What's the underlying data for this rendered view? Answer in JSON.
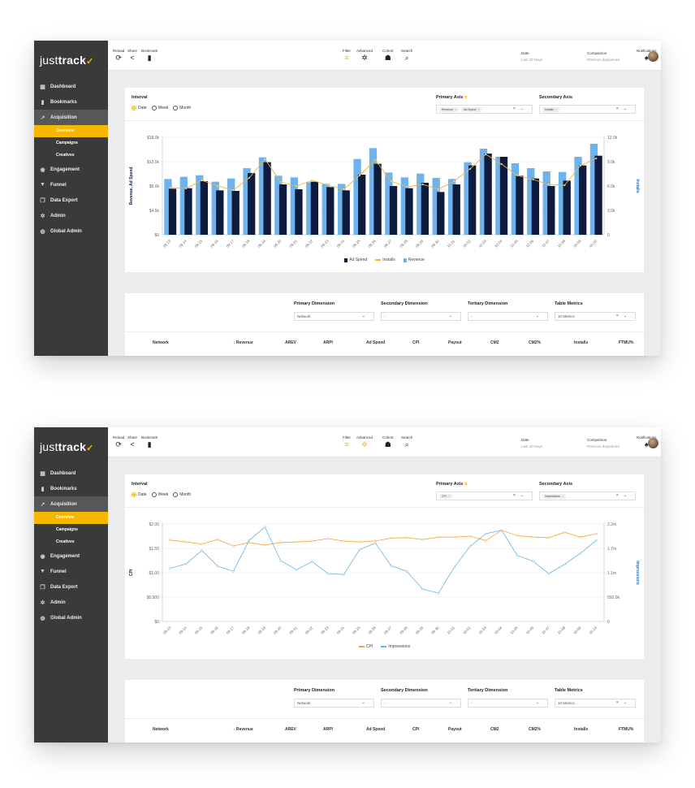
{
  "app": {
    "logo_main": "just",
    "logo_bold": "track",
    "toolbar": {
      "reload": "Reload",
      "share": "Share",
      "bookmark": "Bookmark",
      "filter": "Filter",
      "advanced": "Advanced",
      "cohort": "Cohort",
      "search": "Search"
    },
    "date_label": "Date",
    "date_value": "Last 28 Days",
    "comparison_label": "Comparison",
    "comparison_value": "Previous day/period",
    "notifications": "Notifications",
    "nav": [
      "Dashboard",
      "Bookmarks",
      "Acquisition"
    ],
    "subnav": [
      "Overview",
      "Campaigns",
      "Creatives"
    ],
    "nav2": [
      "Engagement",
      "Funnel",
      "Data Export",
      "Admin",
      "Global Admin"
    ],
    "interval_title": "Interval",
    "intervals": [
      "Date",
      "Week",
      "Month"
    ],
    "primary_axis_title": "Primary Axis",
    "secondary_axis_title": "Secondary Axis",
    "dimensions": {
      "primary": "Primary Dimension",
      "secondary": "Secondary Dimension",
      "tertiary": "Tertiary Dimension",
      "metrics": "Table Metrics",
      "primary_value": "Network",
      "secondary_value": "-",
      "tertiary_value": "-",
      "metrics_value": "10 Metrics"
    },
    "table_headers": [
      "Network",
      "↓ Revenue",
      "AREV",
      "ARPI",
      "Ad Spend",
      "CPI",
      "Payout",
      "CM2",
      "CM2%",
      "Installs",
      "FTMU%"
    ],
    "colors": {
      "accent": "#f5b800",
      "sidebar": "#3a3a3a",
      "revenue": "#6fb3ee",
      "adspend": "#0e1b3d",
      "installs": "#f3b233",
      "cpi": "#f3a233",
      "impressions": "#6ab3e0"
    }
  },
  "screens": [
    {
      "primary_chips": [
        "Revenue",
        "Ad Spend"
      ],
      "secondary_chips": [
        "Installs"
      ],
      "chart_data": {
        "type": "bar",
        "categories": [
          "09.13",
          "09.14",
          "09.15",
          "09.16",
          "09.17",
          "09.18",
          "09.19",
          "09.20",
          "09.21",
          "09.22",
          "09.23",
          "09.24",
          "09.25",
          "09.26",
          "09.27",
          "09.28",
          "09.29",
          "09.30",
          "10.01",
          "10.02",
          "10.03",
          "10.04",
          "10.05",
          "10.06",
          "10.07",
          "10.08",
          "10.09",
          "10.10"
        ],
        "y_ticks": [
          "$0",
          "$4.5k",
          "$9.0k",
          "$13.5k",
          "$18.0k"
        ],
        "y2_ticks": [
          "0",
          "3.0k",
          "6.0k",
          "9.0k",
          "12.0k"
        ],
        "ylabel": "Revenue, Ad Spend",
        "y2label": "Installs",
        "ylim": [
          0,
          18000
        ],
        "y2lim": [
          0,
          12000
        ],
        "series": [
          {
            "name": "Ad Spend",
            "values": [
              8500,
              8600,
              9900,
              8200,
              8100,
              11400,
              13400,
              9300,
              8400,
              9800,
              8800,
              8200,
              11100,
              13100,
              9000,
              8600,
              9600,
              7900,
              9300,
              12800,
              15000,
              14400,
              10900,
              10400,
              9000,
              10000,
              12800,
              14600
            ]
          },
          {
            "name": "Installs",
            "values": [
              5800,
              5700,
              6700,
              6000,
              5500,
              7000,
              9300,
              6500,
              6000,
              6700,
              6100,
              5600,
              7300,
              9200,
              6600,
              5900,
              6200,
              5600,
              6600,
              8100,
              9900,
              8700,
              7300,
              6800,
              6200,
              6100,
              8500,
              9400
            ]
          },
          {
            "name": "Revenue",
            "values": [
              10300,
              10700,
              11000,
              9800,
              10400,
              12300,
              14300,
              10900,
              10600,
              9700,
              9400,
              9400,
              14000,
              16000,
              11500,
              10600,
              11300,
              10500,
              10300,
              13400,
              15900,
              14400,
              13200,
              12300,
              11700,
              11600,
              14400,
              16800
            ]
          }
        ]
      }
    },
    {
      "primary_chips": [
        "CPI"
      ],
      "secondary_chips": [
        "Impressions"
      ],
      "chart_data": {
        "type": "line",
        "categories": [
          "09.13",
          "09.14",
          "09.15",
          "09.16",
          "09.17",
          "09.18",
          "09.19",
          "09.20",
          "09.21",
          "09.22",
          "09.23",
          "09.24",
          "09.25",
          "09.26",
          "09.27",
          "09.28",
          "09.29",
          "09.30",
          "10.01",
          "10.02",
          "10.03",
          "10.04",
          "10.05",
          "10.06",
          "10.07",
          "10.08",
          "10.09",
          "10.10"
        ],
        "y_ticks": [
          "$0",
          "$0.500",
          "$1.00",
          "$1.50",
          "$2.00"
        ],
        "y2_ticks": [
          "0",
          "550.0k",
          "1.1m",
          "1.7m",
          "2.2m"
        ],
        "ylabel": "CPI",
        "y2label": "Impressions",
        "ylim": [
          0,
          2.0
        ],
        "y2lim": [
          0,
          2200000
        ],
        "series": [
          {
            "name": "CPI",
            "values": [
              1.67,
              1.63,
              1.59,
              1.68,
              1.55,
              1.62,
              1.57,
              1.62,
              1.63,
              1.65,
              1.7,
              1.65,
              1.63,
              1.65,
              1.71,
              1.72,
              1.68,
              1.73,
              1.73,
              1.75,
              1.66,
              1.87,
              1.76,
              1.73,
              1.72,
              1.83,
              1.73,
              1.8
            ]
          },
          {
            "name": "Impressions",
            "values": [
              1200000,
              1300000,
              1600000,
              1250000,
              1130000,
              1830000,
              2130000,
              1370000,
              1170000,
              1350000,
              1080000,
              1060000,
              1620000,
              1770000,
              1260000,
              1130000,
              730000,
              640000,
              1220000,
              1690000,
              1980000,
              2060000,
              1490000,
              1360000,
              1080000,
              1290000,
              1540000,
              1830000
            ]
          }
        ]
      }
    }
  ]
}
